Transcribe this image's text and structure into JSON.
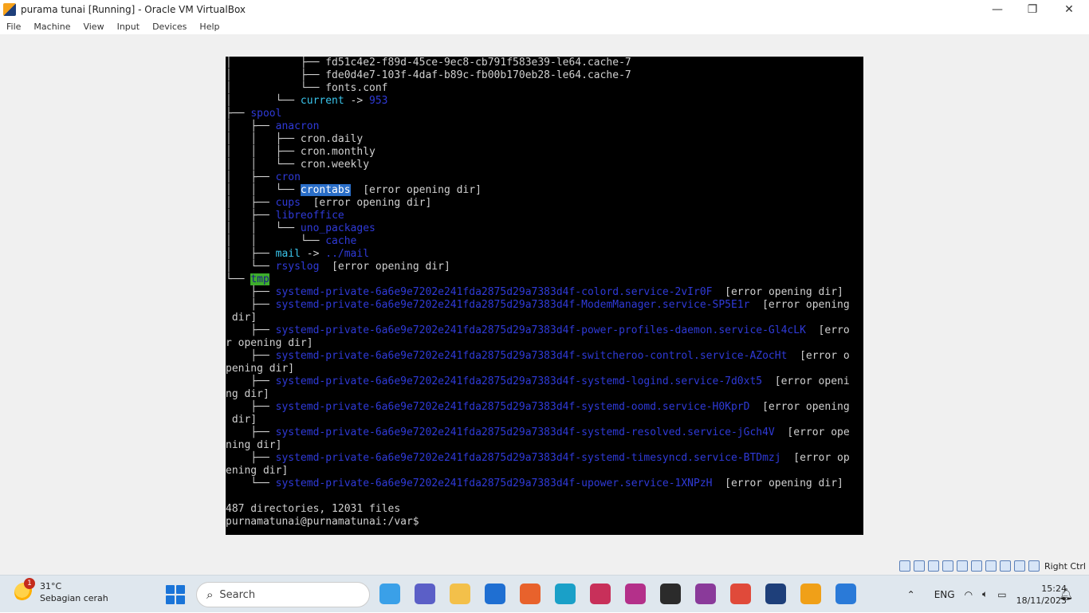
{
  "window": {
    "title": "purama tunai [Running] - Oracle VM VirtualBox",
    "minimize": "—",
    "restore": "❐",
    "close": "✕"
  },
  "menu": [
    "File",
    "Machine",
    "View",
    "Input",
    "Devices",
    "Help"
  ],
  "terminal": {
    "lines": [
      {
        "segments": [
          {
            "text": "│           ├── ",
            "cls": ""
          },
          {
            "text": "fd51c4e2-f89d-45ce-9ec8-cb791f583e39-le64.cache-7",
            "cls": ""
          }
        ]
      },
      {
        "segments": [
          {
            "text": "│           ├── ",
            "cls": ""
          },
          {
            "text": "fde0d4e7-103f-4daf-b89c-fb00b170eb28-le64.cache-7",
            "cls": ""
          }
        ]
      },
      {
        "segments": [
          {
            "text": "│           └── ",
            "cls": ""
          },
          {
            "text": "fonts.conf",
            "cls": ""
          }
        ]
      },
      {
        "segments": [
          {
            "text": "│       └── ",
            "cls": ""
          },
          {
            "text": "current",
            "cls": "lnk"
          },
          {
            "text": " -> ",
            "cls": ""
          },
          {
            "text": "953",
            "cls": "dir"
          }
        ]
      },
      {
        "segments": [
          {
            "text": "├── ",
            "cls": ""
          },
          {
            "text": "spool",
            "cls": "dir"
          }
        ]
      },
      {
        "segments": [
          {
            "text": "│   ├── ",
            "cls": ""
          },
          {
            "text": "anacron",
            "cls": "dir"
          }
        ]
      },
      {
        "segments": [
          {
            "text": "│   │   ├── ",
            "cls": ""
          },
          {
            "text": "cron.daily",
            "cls": ""
          }
        ]
      },
      {
        "segments": [
          {
            "text": "│   │   ├── ",
            "cls": ""
          },
          {
            "text": "cron.monthly",
            "cls": ""
          }
        ]
      },
      {
        "segments": [
          {
            "text": "│   │   └── ",
            "cls": ""
          },
          {
            "text": "cron.weekly",
            "cls": ""
          }
        ]
      },
      {
        "segments": [
          {
            "text": "│   ├── ",
            "cls": ""
          },
          {
            "text": "cron",
            "cls": "dir"
          }
        ]
      },
      {
        "segments": [
          {
            "text": "│   │   └── ",
            "cls": ""
          },
          {
            "text": "crontabs",
            "cls": "hl"
          },
          {
            "text": "  [error opening dir]",
            "cls": ""
          }
        ]
      },
      {
        "segments": [
          {
            "text": "│   ├── ",
            "cls": ""
          },
          {
            "text": "cups",
            "cls": "dir"
          },
          {
            "text": "  [error opening dir]",
            "cls": ""
          }
        ]
      },
      {
        "segments": [
          {
            "text": "│   ├── ",
            "cls": ""
          },
          {
            "text": "libreoffice",
            "cls": "dir"
          }
        ]
      },
      {
        "segments": [
          {
            "text": "│   │   └── ",
            "cls": ""
          },
          {
            "text": "uno_packages",
            "cls": "dir"
          }
        ]
      },
      {
        "segments": [
          {
            "text": "│   │       └── ",
            "cls": ""
          },
          {
            "text": "cache",
            "cls": "dir"
          }
        ]
      },
      {
        "segments": [
          {
            "text": "│   ├── ",
            "cls": ""
          },
          {
            "text": "mail",
            "cls": "lnk"
          },
          {
            "text": " -> ",
            "cls": ""
          },
          {
            "text": "../mail",
            "cls": "dir"
          }
        ]
      },
      {
        "segments": [
          {
            "text": "│   └── ",
            "cls": ""
          },
          {
            "text": "rsyslog",
            "cls": "dir"
          },
          {
            "text": "  [error opening dir]",
            "cls": ""
          }
        ]
      },
      {
        "segments": [
          {
            "text": "└── ",
            "cls": ""
          },
          {
            "text": "tmp",
            "cls": "tmp"
          }
        ]
      },
      {
        "segments": [
          {
            "text": "    ├── ",
            "cls": ""
          },
          {
            "text": "systemd-private-6a6e9e7202e241fda2875d29a7383d4f-colord.service-2vIr0F",
            "cls": "dir"
          },
          {
            "text": "  [error opening dir]",
            "cls": ""
          }
        ]
      },
      {
        "segments": [
          {
            "text": "    ├── ",
            "cls": ""
          },
          {
            "text": "systemd-private-6a6e9e7202e241fda2875d29a7383d4f-ModemManager.service-SP5E1r",
            "cls": "dir"
          },
          {
            "text": "  [error opening",
            "cls": ""
          }
        ]
      },
      {
        "segments": [
          {
            "text": " dir]",
            "cls": ""
          }
        ]
      },
      {
        "segments": [
          {
            "text": "    ├── ",
            "cls": ""
          },
          {
            "text": "systemd-private-6a6e9e7202e241fda2875d29a7383d4f-power-profiles-daemon.service-Gl4cLK",
            "cls": "dir"
          },
          {
            "text": "  [erro",
            "cls": ""
          }
        ]
      },
      {
        "segments": [
          {
            "text": "r opening dir]",
            "cls": ""
          }
        ]
      },
      {
        "segments": [
          {
            "text": "    ├── ",
            "cls": ""
          },
          {
            "text": "systemd-private-6a6e9e7202e241fda2875d29a7383d4f-switcheroo-control.service-AZocHt",
            "cls": "dir"
          },
          {
            "text": "  [error o",
            "cls": ""
          }
        ]
      },
      {
        "segments": [
          {
            "text": "pening dir]",
            "cls": ""
          }
        ]
      },
      {
        "segments": [
          {
            "text": "    ├── ",
            "cls": ""
          },
          {
            "text": "systemd-private-6a6e9e7202e241fda2875d29a7383d4f-systemd-logind.service-7d0xt5",
            "cls": "dir"
          },
          {
            "text": "  [error openi",
            "cls": ""
          }
        ]
      },
      {
        "segments": [
          {
            "text": "ng dir]",
            "cls": ""
          }
        ]
      },
      {
        "segments": [
          {
            "text": "    ├── ",
            "cls": ""
          },
          {
            "text": "systemd-private-6a6e9e7202e241fda2875d29a7383d4f-systemd-oomd.service-H0KprD",
            "cls": "dir"
          },
          {
            "text": "  [error opening",
            "cls": ""
          }
        ]
      },
      {
        "segments": [
          {
            "text": " dir]",
            "cls": ""
          }
        ]
      },
      {
        "segments": [
          {
            "text": "    ├── ",
            "cls": ""
          },
          {
            "text": "systemd-private-6a6e9e7202e241fda2875d29a7383d4f-systemd-resolved.service-jGch4V",
            "cls": "dir"
          },
          {
            "text": "  [error ope",
            "cls": ""
          }
        ]
      },
      {
        "segments": [
          {
            "text": "ning dir]",
            "cls": ""
          }
        ]
      },
      {
        "segments": [
          {
            "text": "    ├── ",
            "cls": ""
          },
          {
            "text": "systemd-private-6a6e9e7202e241fda2875d29a7383d4f-systemd-timesyncd.service-BTDmzj",
            "cls": "dir"
          },
          {
            "text": "  [error op",
            "cls": ""
          }
        ]
      },
      {
        "segments": [
          {
            "text": "ening dir]",
            "cls": ""
          }
        ]
      },
      {
        "segments": [
          {
            "text": "    └── ",
            "cls": ""
          },
          {
            "text": "systemd-private-6a6e9e7202e241fda2875d29a7383d4f-upower.service-1XNPzH",
            "cls": "dir"
          },
          {
            "text": "  [error opening dir]",
            "cls": ""
          }
        ]
      },
      {
        "segments": [
          {
            "text": "",
            "cls": ""
          }
        ]
      },
      {
        "segments": [
          {
            "text": "487 directories, 12031 files",
            "cls": ""
          }
        ]
      },
      {
        "segments": [
          {
            "text": "purnamatunai@purnamatunai:/var$",
            "cls": ""
          }
        ]
      }
    ]
  },
  "statusbar": {
    "host_key": "Right Ctrl",
    "icon_names": [
      "hdd-icon",
      "optical-icon",
      "audio-icon",
      "network-icon",
      "usb-icon",
      "shared-folder-icon",
      "display-icon",
      "recording-icon",
      "mouse-icon",
      "keyboard-icon"
    ]
  },
  "taskbar": {
    "weather_temp": "31°C",
    "weather_desc": "Sebagian cerah",
    "weather_badge": "1",
    "search_label": "Search",
    "apps": [
      {
        "name": "copilot-icon",
        "color": "#3aa0e8"
      },
      {
        "name": "teams-icon",
        "color": "#5b5fc7"
      },
      {
        "name": "file-explorer-icon",
        "color": "#f3c04a"
      },
      {
        "name": "vscode-like-icon",
        "color": "#1f6fd2"
      },
      {
        "name": "firefox-icon",
        "color": "#e8622c"
      },
      {
        "name": "edge-icon",
        "color": "#1aa0c8"
      },
      {
        "name": "snipping-tool-icon",
        "color": "#c8305a"
      },
      {
        "name": "wps-icon",
        "color": "#b4308a"
      },
      {
        "name": "terminal-icon",
        "color": "#2b2b2b"
      },
      {
        "name": "winrar-icon",
        "color": "#8a3a9a"
      },
      {
        "name": "chrome-icon",
        "color": "#e04a3a"
      },
      {
        "name": "virtualbox-icon",
        "color": "#1e3f7a"
      },
      {
        "name": "vm-app-icon",
        "color": "#f0a018"
      },
      {
        "name": "paint-icon",
        "color": "#2a7ad8"
      }
    ],
    "tray_chevron": "⌃",
    "language": "ENG",
    "time": "15:24",
    "date": "18/11/2023"
  }
}
